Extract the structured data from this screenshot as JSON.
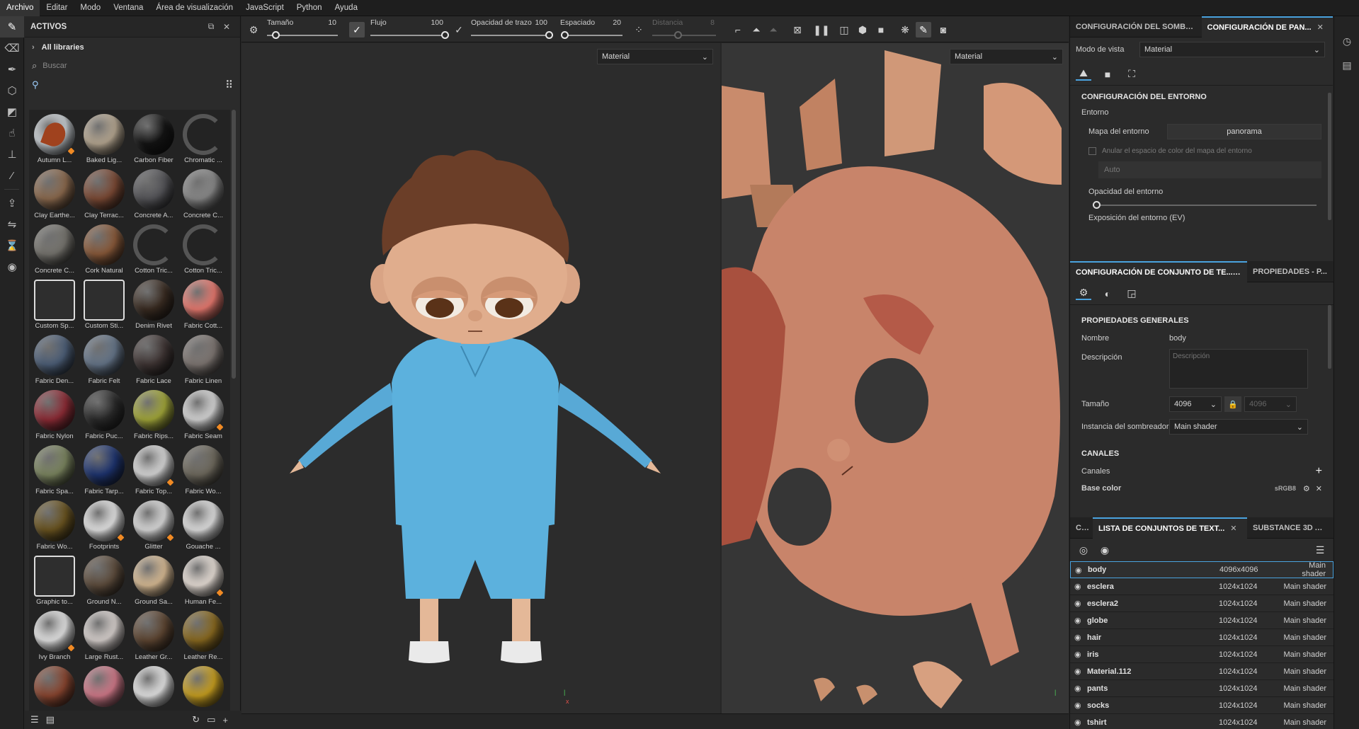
{
  "menu": [
    "Archivo",
    "Editar",
    "Modo",
    "Ventana",
    "Área de visualización",
    "JavaScript",
    "Python",
    "Ayuda"
  ],
  "assets": {
    "title": "ACTIVOS",
    "library": "All libraries",
    "search_placeholder": "Buscar",
    "items": [
      {
        "label": "Autumn L...",
        "color": "#c9cfd4",
        "accent": "#a0421e",
        "badge": true
      },
      {
        "label": "Baked Lig...",
        "color": "#b7a892"
      },
      {
        "label": "Carbon Fiber",
        "color": "#141414"
      },
      {
        "label": "Chromatic ...",
        "color": "ring"
      },
      {
        "label": "Clay Earthe...",
        "color": "#8c6a4e"
      },
      {
        "label": "Clay Terrac...",
        "color": "#7c4a35"
      },
      {
        "label": "Concrete A...",
        "color": "#555559"
      },
      {
        "label": "Concrete C...",
        "color": "#8a8a8a"
      },
      {
        "label": "Concrete C...",
        "color": "#77756f"
      },
      {
        "label": "Cork Natural",
        "color": "#8a5a3a"
      },
      {
        "label": "Cotton Tric...",
        "color": "ring"
      },
      {
        "label": "Cotton Tric...",
        "color": "ring"
      },
      {
        "label": "Custom Sp...",
        "color": "icon"
      },
      {
        "label": "Custom Sti...",
        "color": "icon"
      },
      {
        "label": "Denim Rivet",
        "color": "#3a2c22"
      },
      {
        "label": "Fabric Cott...",
        "color": "#e97a70"
      },
      {
        "label": "Fabric Den...",
        "color": "#4d5f78"
      },
      {
        "label": "Fabric Felt",
        "color": "#66768a"
      },
      {
        "label": "Fabric Lace",
        "color": "#3f3534"
      },
      {
        "label": "Fabric Linen",
        "color": "#7f7773"
      },
      {
        "label": "Fabric Nylon",
        "color": "#8e2c36"
      },
      {
        "label": "Fabric Puc...",
        "color": "#2a2a2a"
      },
      {
        "label": "Fabric Rips...",
        "color": "#a3a83a"
      },
      {
        "label": "Fabric Seam",
        "color": "#d8d8d8",
        "badge": true
      },
      {
        "label": "Fabric Spa...",
        "color": "#7c8660"
      },
      {
        "label": "Fabric Tarp...",
        "color": "#1e3470"
      },
      {
        "label": "Fabric Top...",
        "color": "#dadada",
        "badge": true
      },
      {
        "label": "Fabric Wo...",
        "color": "#6f6a5e"
      },
      {
        "label": "Fabric Wo...",
        "color": "#6a5420"
      },
      {
        "label": "Footprints",
        "color": "#e6e6e6",
        "badge": true
      },
      {
        "label": "Glitter",
        "color": "#dcdcdc",
        "badge": true
      },
      {
        "label": "Gouache ...",
        "color": "#e2e2e2"
      },
      {
        "label": "Graphic to...",
        "color": "icon"
      },
      {
        "label": "Ground N...",
        "color": "#5e4d3d"
      },
      {
        "label": "Ground Sa...",
        "color": "#d9bc95"
      },
      {
        "label": "Human Fe...",
        "color": "#e9e0d8",
        "badge": true
      },
      {
        "label": "Ivy Branch",
        "color": "#e6e6e6",
        "badge": true
      },
      {
        "label": "Large Rust...",
        "color": "#d9d2cf"
      },
      {
        "label": "Leather Gr...",
        "color": "#5e4632"
      },
      {
        "label": "Leather Re...",
        "color": "#8a6a20"
      },
      {
        "label": "",
        "color": "#8a4630"
      },
      {
        "label": "",
        "color": "#d27a8a"
      },
      {
        "label": "",
        "color": "#e6e6e6"
      },
      {
        "label": "",
        "color": "#c9a020"
      }
    ]
  },
  "toolbar": {
    "size_label": "Tamaño",
    "size_value": "10",
    "size_frac": 0.12,
    "flow_label": "Flujo",
    "flow_value": "100",
    "flow_frac": 1.0,
    "stroke_opacity_label": "Opacidad de trazo",
    "stroke_opacity_value": "100",
    "stroke_opacity_frac": 1.0,
    "spacing_label": "Espaciado",
    "spacing_value": "20",
    "spacing_frac": 0.0,
    "distance_label": "Distancia",
    "distance_value": "8",
    "distance_frac": 0.4
  },
  "viewport3d": {
    "view_mode": "Material"
  },
  "viewport2d": {
    "view_mode": "Material"
  },
  "shader_panel": {
    "tab1": "CONFIGURACIÓN DEL SOMBRE...",
    "tab2": "CONFIGURACIÓN DE PAN...",
    "view_mode_label": "Modo de vista",
    "view_mode_value": "Material",
    "section": "CONFIGURACIÓN DEL ENTORNO",
    "env_label": "Entorno",
    "env_map_label": "Mapa del entorno",
    "env_map_value": "panorama",
    "override_label": "Anular el espacio de color del mapa del entorno",
    "auto_value": "Auto",
    "env_opacity_label": "Opacidad del entorno",
    "env_exposure_label": "Exposición del entorno (EV)"
  },
  "texset_panel": {
    "tab1": "CONFIGURACIÓN DE CONJUNTO DE TE...",
    "tab2": "PROPIEDADES - P...",
    "section": "PROPIEDADES GENERALES",
    "name_label": "Nombre",
    "name_value": "body",
    "desc_label": "Descripción",
    "desc_placeholder": "Descripción",
    "size_label": "Tamaño",
    "size_value": "4096",
    "size_value2": "4096",
    "shader_label": "Instancia del sombreador",
    "shader_value": "Main shader",
    "channels_section": "CANALES",
    "channels_label": "Canales",
    "base_color_label": "Base color",
    "base_color_space": "sRGB8"
  },
  "texlist_panel": {
    "tab0": "C...",
    "tab1": "LISTA DE CONJUNTOS DE TEXT...",
    "tab2": "SUBSTANCE 3D AS...",
    "rows": [
      {
        "name": "body",
        "size": "4096x4096",
        "shader": "Main shader"
      },
      {
        "name": "esclera",
        "size": "1024x1024",
        "shader": "Main shader"
      },
      {
        "name": "esclera2",
        "size": "1024x1024",
        "shader": "Main shader"
      },
      {
        "name": "globe",
        "size": "1024x1024",
        "shader": "Main shader"
      },
      {
        "name": "hair",
        "size": "1024x1024",
        "shader": "Main shader"
      },
      {
        "name": "iris",
        "size": "1024x1024",
        "shader": "Main shader"
      },
      {
        "name": "Material.112",
        "size": "1024x1024",
        "shader": "Main shader"
      },
      {
        "name": "pants",
        "size": "1024x1024",
        "shader": "Main shader"
      },
      {
        "name": "socks",
        "size": "1024x1024",
        "shader": "Main shader"
      },
      {
        "name": "tshirt",
        "size": "1024x1024",
        "shader": "Main shader"
      }
    ]
  }
}
